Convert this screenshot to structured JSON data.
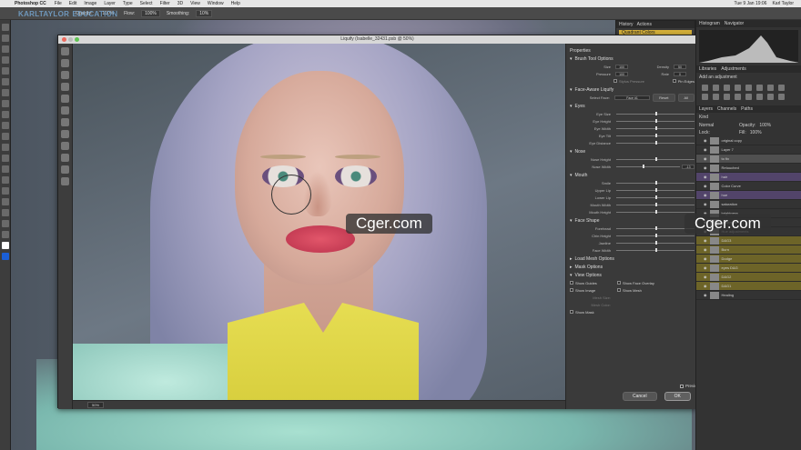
{
  "menubar": {
    "app_name": "Photoshop CC",
    "items": [
      "File",
      "Edit",
      "Image",
      "Layer",
      "Type",
      "Select",
      "Filter",
      "3D",
      "View",
      "Window",
      "Help"
    ],
    "datetime": "Tue 9 Jan 19:06",
    "user": "Karl Taylor"
  },
  "logo": {
    "text": "KARLTAYLOR",
    "sub": "EDUCATION"
  },
  "options_bar": {
    "opacity_label": "Opacity:",
    "opacity_value": "100%",
    "flow_label": "Flow:",
    "flow_value": "100%",
    "smoothing_label": "Smoothing:",
    "smoothing_value": "10%"
  },
  "dialog": {
    "title": "Liquify (Isabelle_32431.psb @ 50%)",
    "zoom": "50%",
    "properties_title": "Properties",
    "brush_tool_options": "Brush Tool Options",
    "brush_rows": [
      {
        "label": "Size",
        "value": "100"
      },
      {
        "label": "Density",
        "value": "50"
      },
      {
        "label": "Pressure",
        "value": "100"
      },
      {
        "label": "Rate",
        "value": "0"
      }
    ],
    "stylus_pressure": "Stylus Pressure",
    "pin_edges": "Pin Edges",
    "face_aware": "Face-Aware Liquify",
    "select_face_label": "Select Face:",
    "select_face_value": "Face #1",
    "reset_label": "Reset",
    "all_label": "All",
    "eyes_section": "Eyes",
    "eye_rows": [
      "Eye Size",
      "Eye Height",
      "Eye Width",
      "Eye Tilt",
      "Eye Distance"
    ],
    "nose_section": "Nose",
    "nose_rows": [
      "Nose Height",
      "Nose Width"
    ],
    "nose_width_value": "-13",
    "mouth_section": "Mouth",
    "mouth_rows": [
      "Smile",
      "Upper Lip",
      "Lower Lip",
      "Mouth Width",
      "Mouth Height"
    ],
    "face_shape_section": "Face Shape",
    "face_shape_rows": [
      "Forehead",
      "Chin Height",
      "Jawline",
      "Face Width"
    ],
    "load_mesh_options": "Load Mesh Options",
    "mask_options": "Mask Options",
    "view_options": "View Options",
    "show_guides": "Show Guides",
    "show_face_overlay": "Show Face Overlay",
    "show_image": "Show Image",
    "show_mesh": "Show Mesh",
    "mesh_size": "Mesh Size:",
    "mesh_color": "Mesh Color:",
    "show_mask": "Show Mask",
    "preview_label": "Preview",
    "cancel_label": "Cancel",
    "ok_label": "OK"
  },
  "actions_panel": {
    "tabs": [
      "History",
      "Actions"
    ],
    "selected": "Quadrant Colors"
  },
  "right_panel": {
    "top_tabs": [
      "Histogram",
      "Navigator"
    ],
    "adj_tabs": [
      "Libraries",
      "Adjustments"
    ],
    "add_adjustment": "Add an adjustment",
    "layers_tabs": [
      "Layers",
      "Channels",
      "Paths"
    ],
    "kind_label": "Kind",
    "blend_mode": "Normal",
    "opacity_label": "Opacity:",
    "opacity_value": "100%",
    "lock_label": "Lock:",
    "fill_label": "Fill:",
    "fill_value": "100%",
    "layers": [
      {
        "name": "original copy",
        "style": "normal"
      },
      {
        "name": "Layer 7",
        "style": "normal"
      },
      {
        "name": "to fix",
        "style": "sel"
      },
      {
        "name": "Retouched",
        "style": "normal"
      },
      {
        "name": "hair",
        "style": "purple"
      },
      {
        "name": "Color Curve",
        "style": "normal"
      },
      {
        "name": "hue",
        "style": "purple"
      },
      {
        "name": "saturation",
        "style": "normal"
      },
      {
        "name": "brightness",
        "style": "normal"
      },
      {
        "name": "saturation",
        "style": "normal"
      },
      {
        "name": "Hue adjustments",
        "style": "normal"
      },
      {
        "name": "D&G3",
        "style": "yellow"
      },
      {
        "name": "Burn",
        "style": "yellow"
      },
      {
        "name": "Dodge",
        "style": "yellow"
      },
      {
        "name": "eyes D&G",
        "style": "yellow"
      },
      {
        "name": "D&G2",
        "style": "yellow"
      },
      {
        "name": "D&G1",
        "style": "yellow"
      },
      {
        "name": "Healing",
        "style": "normal"
      }
    ]
  },
  "watermarks": [
    "Cger.com",
    "Cger.com"
  ]
}
